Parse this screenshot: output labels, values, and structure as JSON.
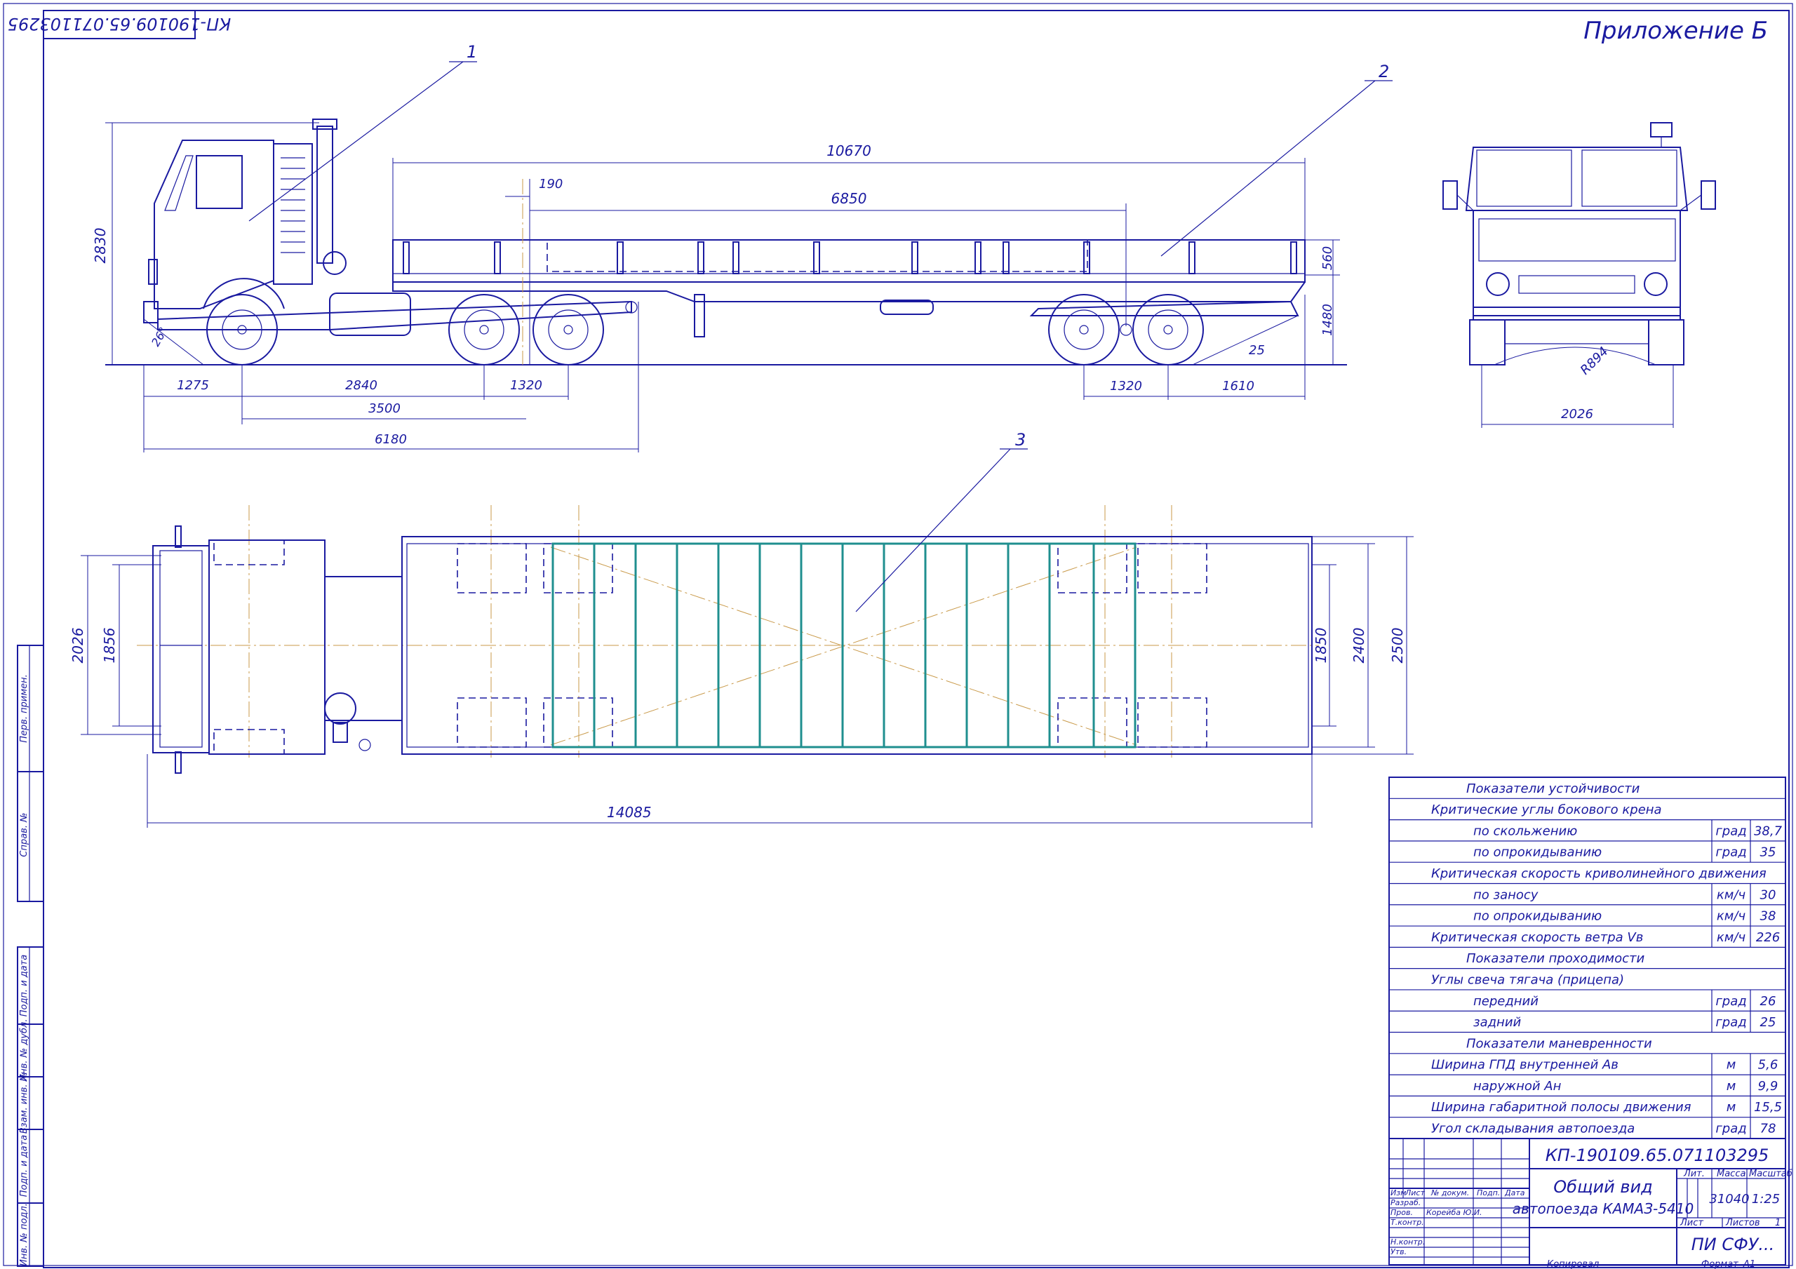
{
  "header": {
    "appendix": "Приложение Б",
    "stamp_code_rotated": "КП-190109.65.071103295"
  },
  "leaders": [
    "1",
    "2",
    "3"
  ],
  "side_dims": {
    "height_total": "2830",
    "bed_height": "560",
    "frame_height": "1480",
    "total_platform": "10670",
    "offset_190": "190",
    "span_6850": "6850",
    "front_overhang": "1275",
    "wb_2840": "2840",
    "bogie_1320_a": "1320",
    "wb_3500": "3500",
    "len_6180": "6180",
    "bogie_1320_b": "1320",
    "rear_1610": "1610",
    "angle_front": "26°",
    "angle_rear": "25"
  },
  "front_dims": {
    "track": "2026",
    "radius": "R894"
  },
  "plan_dims": {
    "width_2026": "2026",
    "width_1856": "1856",
    "width_1850": "1850",
    "width_2400": "2400",
    "width_2500": "2500",
    "length_total": "14085"
  },
  "stability_table": {
    "rows": [
      {
        "label": "Показатели устойчивости",
        "unit": "",
        "value": "",
        "indent": 1
      },
      {
        "label": "Критические углы бокового крена",
        "unit": "",
        "value": "",
        "indent": 2
      },
      {
        "label": "по скольжению",
        "unit": "град",
        "value": "38,7",
        "indent": 3
      },
      {
        "label": "по опрокидыванию",
        "unit": "град",
        "value": "35",
        "indent": 3
      },
      {
        "label": "Критическая скорость криволинейного движения",
        "unit": "",
        "value": "",
        "indent": 2
      },
      {
        "label": "по заносу",
        "unit": "км/ч",
        "value": "30",
        "indent": 3
      },
      {
        "label": "по опрокидыванию",
        "unit": "км/ч",
        "value": "38",
        "indent": 3
      },
      {
        "label": "Критическая скорость ветра Vв",
        "unit": "км/ч",
        "value": "226",
        "indent": 2
      },
      {
        "label": "Показатели проходимости",
        "unit": "",
        "value": "",
        "indent": 1
      },
      {
        "label": "Углы свеча тягача (прицепа)",
        "unit": "",
        "value": "",
        "indent": 2
      },
      {
        "label": "передний",
        "unit": "град",
        "value": "26",
        "indent": 3
      },
      {
        "label": "задний",
        "unit": "град",
        "value": "25",
        "indent": 3
      },
      {
        "label": "Показатели маневренности",
        "unit": "",
        "value": "",
        "indent": 1
      },
      {
        "label": "Ширина ГПД внутренней Ав",
        "unit": "м",
        "value": "5,6",
        "indent": 2
      },
      {
        "label": "наружной Ан",
        "unit": "м",
        "value": "9,9",
        "indent": 3
      },
      {
        "label": "Ширина габаритной полосы движения",
        "unit": "м",
        "value": "15,5",
        "indent": 2
      },
      {
        "label": "Угол складывания автопоезда",
        "unit": "град",
        "value": "78",
        "indent": 2
      }
    ]
  },
  "title_block": {
    "doc_code": "КП-190109.65.071103295",
    "title_line1": "Общий вид",
    "title_line2": "автопоезда КАМАЗ-5410",
    "col_izm": "Изм",
    "col_list": "Лист",
    "col_doc": "№ докум.",
    "col_sign": "Подп.",
    "col_date": "Дата",
    "razrab": "Разраб.",
    "prov": "Пров.",
    "prov_name": "Корейба Ю.И.",
    "tkontr": "Т.контр.",
    "nkontr": "Н.контр.",
    "utv": "Утв.",
    "lit": "Лит.",
    "massa": "Масса",
    "masshtab": "Масштаб",
    "mass_value": "31040",
    "scale_value": "1:25",
    "sheet": "Лист",
    "sheets": "Листов",
    "sheets_value": "1",
    "org": "ПИ СФУ...",
    "copied": "Копировал",
    "format": "Формат",
    "format_value": "А1"
  },
  "side_stamp": {
    "perv_primen": "Перв. примен.",
    "sprav": "Справ. №",
    "podp_data_1": "Подп. и дата",
    "inv_dubl": "Инв. № дубл.",
    "vzam_inv": "Взам. инв. №",
    "podp_data_2": "Подп. и дата",
    "inv_podl": "Инв. № подл."
  }
}
